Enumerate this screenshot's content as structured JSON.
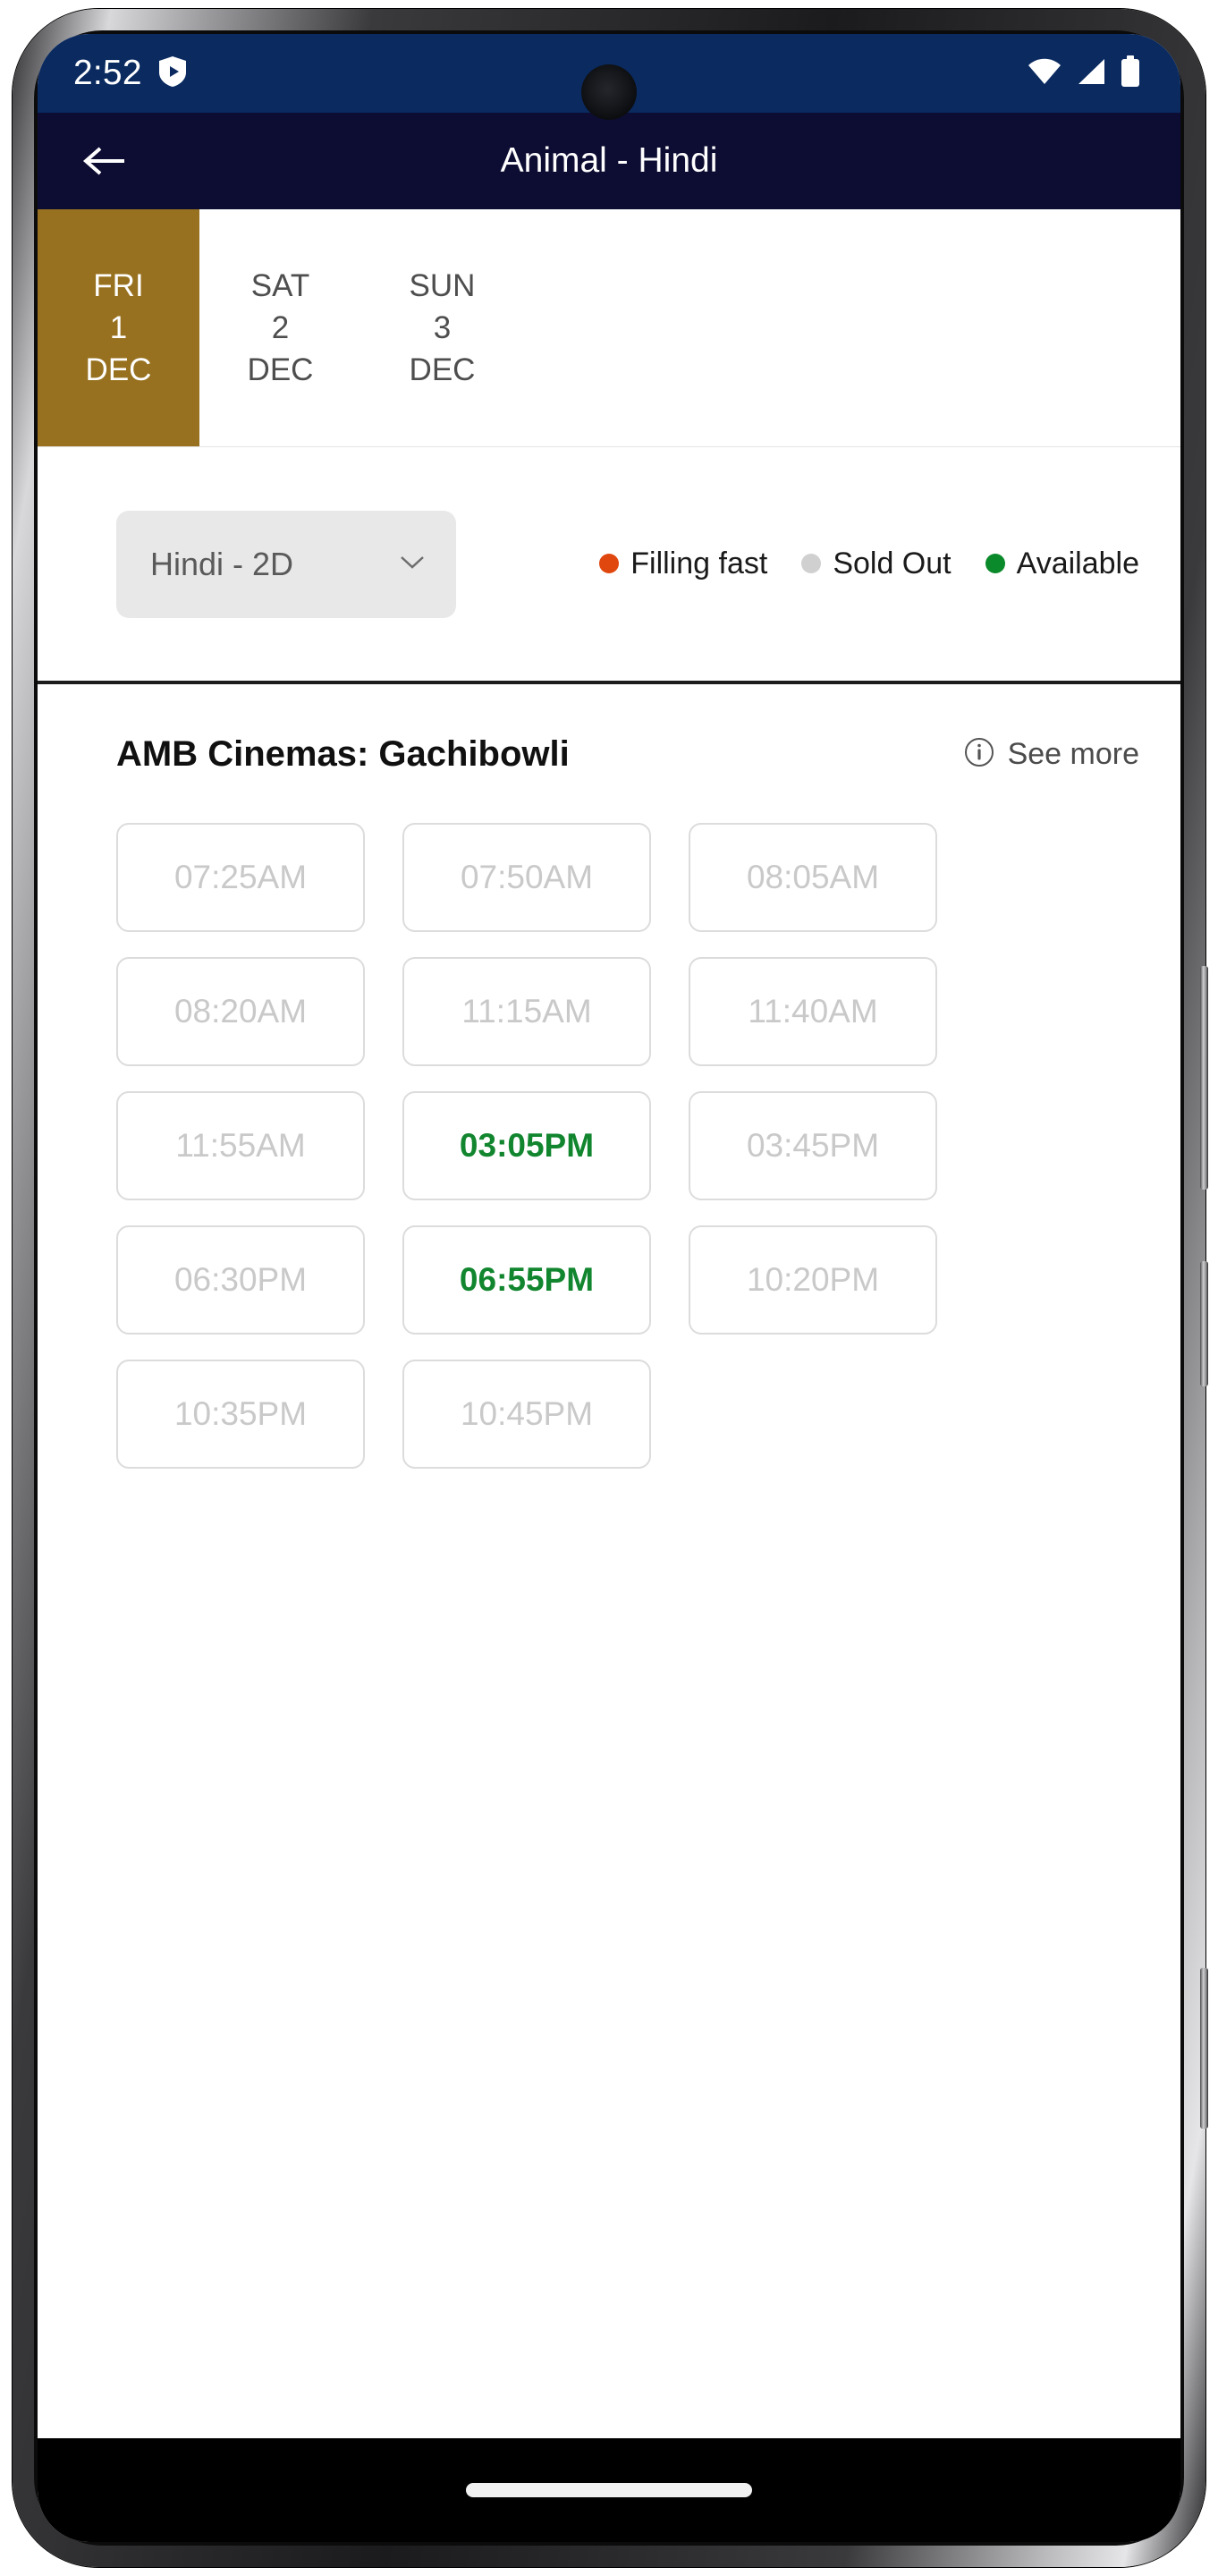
{
  "status_bar": {
    "time": "2:52",
    "shield_icon": "shield-play-icon",
    "wifi_icon": "wifi-icon",
    "signal_icon": "cellular-signal-icon",
    "battery_icon": "battery-full-icon",
    "background_color": "#0a2a60"
  },
  "app_bar": {
    "back_icon": "back-arrow-icon",
    "title": "Animal - Hindi",
    "background_color": "#0d0d33"
  },
  "date_strip": {
    "selected_color": "#97711f",
    "dates": [
      {
        "dow": "FRI",
        "day": "1",
        "month": "DEC",
        "selected": true
      },
      {
        "dow": "SAT",
        "day": "2",
        "month": "DEC",
        "selected": false
      },
      {
        "dow": "SUN",
        "day": "3",
        "month": "DEC",
        "selected": false
      }
    ]
  },
  "filter_row": {
    "language_dropdown": {
      "value": "Hindi - 2D",
      "chevron_icon": "chevron-down-icon"
    },
    "legend": [
      {
        "label": "Filling fast",
        "color": "#e0470f"
      },
      {
        "label": "Sold Out",
        "color": "#d0d0d0"
      },
      {
        "label": "Available",
        "color": "#0a8a2a"
      }
    ]
  },
  "cinema": {
    "name": "AMB Cinemas: Gachibowli",
    "info_icon": "info-circle-icon",
    "see_more_label": "See more"
  },
  "showtimes": [
    {
      "time": "07:25AM",
      "status": "soldout"
    },
    {
      "time": "07:50AM",
      "status": "soldout"
    },
    {
      "time": "08:05AM",
      "status": "soldout"
    },
    {
      "time": "08:20AM",
      "status": "soldout"
    },
    {
      "time": "11:15AM",
      "status": "soldout"
    },
    {
      "time": "11:40AM",
      "status": "soldout"
    },
    {
      "time": "11:55AM",
      "status": "soldout"
    },
    {
      "time": "03:05PM",
      "status": "available"
    },
    {
      "time": "03:45PM",
      "status": "soldout"
    },
    {
      "time": "06:30PM",
      "status": "soldout"
    },
    {
      "time": "06:55PM",
      "status": "available"
    },
    {
      "time": "10:20PM",
      "status": "soldout"
    },
    {
      "time": "10:35PM",
      "status": "soldout"
    },
    {
      "time": "10:45PM",
      "status": "soldout"
    }
  ],
  "nav_bar": {
    "gesture_pill": "home-gesture-pill"
  }
}
